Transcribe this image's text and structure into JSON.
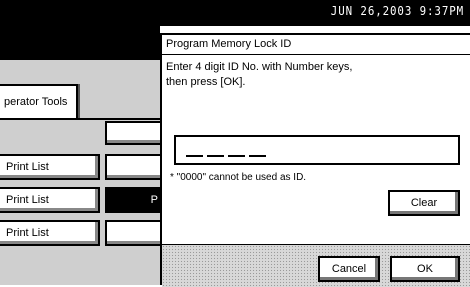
{
  "status_bar": {
    "datetime": "JUN  26,2003  9:37PM"
  },
  "background": {
    "tab_label": "perator Tools",
    "list_buttons": [
      "Print List",
      "Print List",
      "Print List"
    ],
    "middle_buttons": [
      "",
      "",
      "P",
      ""
    ]
  },
  "dialog": {
    "title": "Program Memory Lock ID",
    "message_line1": "Enter 4 digit ID No. with Number keys,",
    "message_line2": "then press [OK].",
    "note": "* \"0000\" cannot be used as ID.",
    "clear_label": "Clear",
    "cancel_label": "Cancel",
    "ok_label": "OK"
  }
}
